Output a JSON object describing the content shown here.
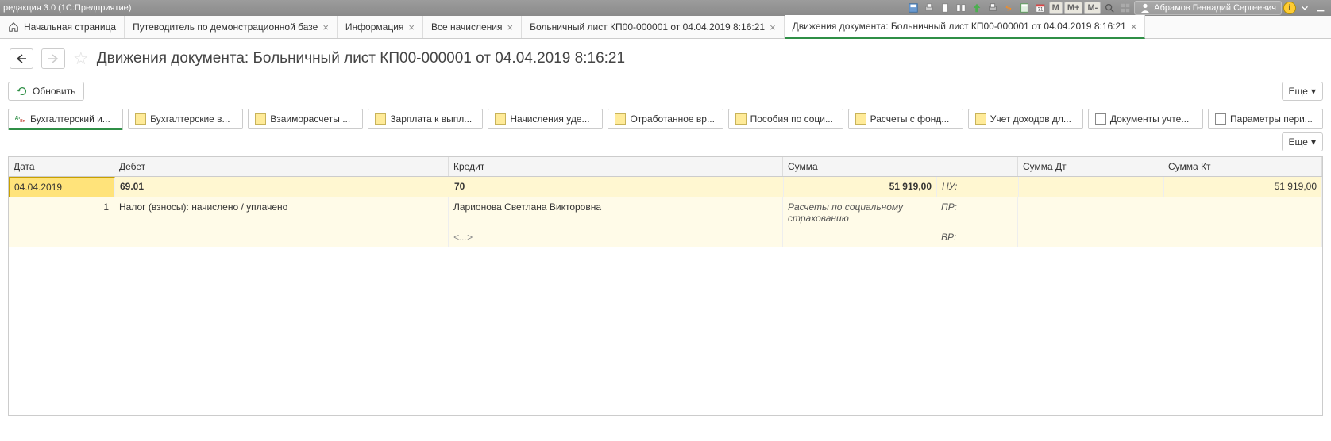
{
  "titlebar": {
    "title": "редакция 3.0 (1С:Предприятие)",
    "user": "Абрамов Геннадий Сергеевич",
    "m": "M",
    "mp": "M+",
    "mm": "M-"
  },
  "tabs": {
    "home": "Начальная страница",
    "items": [
      {
        "label": "Путеводитель по демонстрационной базе"
      },
      {
        "label": "Информация"
      },
      {
        "label": "Все начисления"
      },
      {
        "label": "Больничный лист КП00-000001 от 04.04.2019 8:16:21"
      },
      {
        "label": "Движения документа: Больничный лист КП00-000001 от 04.04.2019 8:16:21"
      }
    ]
  },
  "page": {
    "title": "Движения документа: Больничный лист КП00-000001 от 04.04.2019 8:16:21",
    "refresh_label": "Обновить",
    "more_label": "Еще"
  },
  "subtabs": [
    {
      "label": "Бухгалтерский и...",
      "icon": "dtk"
    },
    {
      "label": "Бухгалтерские в...",
      "icon": "sq"
    },
    {
      "label": "Взаиморасчеты ...",
      "icon": "sq"
    },
    {
      "label": "Зарплата к выпл...",
      "icon": "sq"
    },
    {
      "label": "Начисления уде...",
      "icon": "sq"
    },
    {
      "label": "Отработанное вр...",
      "icon": "sq"
    },
    {
      "label": "Пособия по соци...",
      "icon": "sq"
    },
    {
      "label": "Расчеты с фонд...",
      "icon": "sq"
    },
    {
      "label": "Учет доходов дл...",
      "icon": "sq"
    },
    {
      "label": "Документы учте...",
      "icon": "grid"
    },
    {
      "label": "Параметры пери...",
      "icon": "grid"
    }
  ],
  "grid": {
    "headers": {
      "date": "Дата",
      "debit": "Дебет",
      "credit": "Кредит",
      "sum": "Сумма",
      "sumdt": "Сумма Дт",
      "sumkt": "Сумма Кт"
    },
    "row1": {
      "date": "04.04.2019",
      "debit_acc": "69.01",
      "credit_acc": "70",
      "sum": "51 919,00",
      "label_nu": "НУ:",
      "sumkt": "51 919,00"
    },
    "row2": {
      "num": "1",
      "debit_desc": "Налог (взносы): начислено / уплачено",
      "credit_desc": "Ларионова Светлана Викторовна",
      "sum_desc": "Расчеты по социальному страхованию",
      "label_pr": "ПР:"
    },
    "row3": {
      "credit_extra": "<...>",
      "label_vr": "ВР:"
    }
  }
}
